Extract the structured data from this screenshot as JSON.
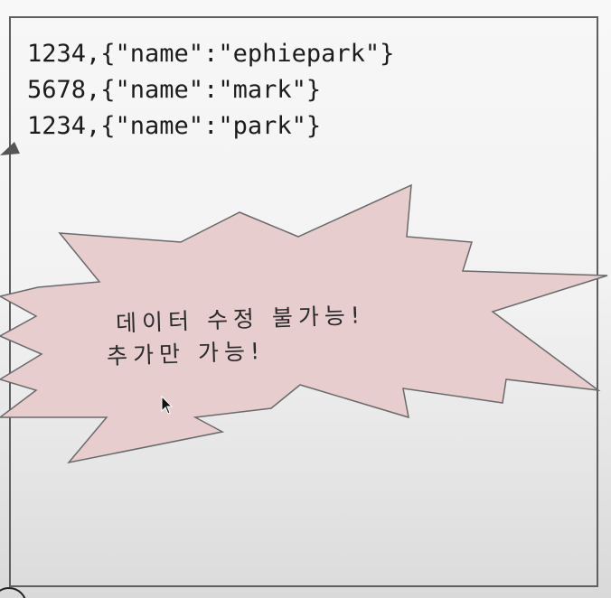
{
  "records": [
    "1234,{\"name\":\"ephiepark\"}",
    "5678,{\"name\":\"mark\"}",
    "1234,{\"name\":\"park\"}"
  ],
  "note": {
    "line1": "데이터 수정 불가능!",
    "line2": "추가만 가능!"
  },
  "colors": {
    "burst_fill": "#e8cdce",
    "burst_stroke": "#6a6a6a",
    "panel_border": "#5f5f5f",
    "text": "#1c1c1c"
  },
  "icons": {
    "arrow": "arrow-head-icon",
    "cursor": "mouse-pointer-icon"
  }
}
